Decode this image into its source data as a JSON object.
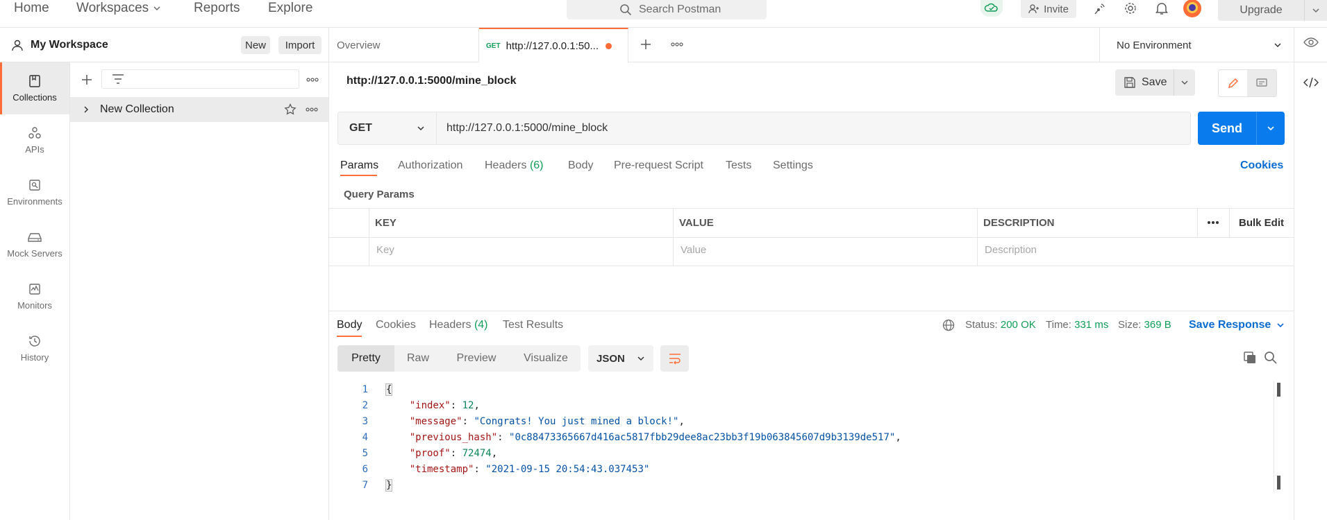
{
  "topbar": {
    "nav": [
      "Home",
      "Workspaces",
      "Reports",
      "Explore"
    ],
    "search_placeholder": "Search Postman",
    "invite_label": "Invite",
    "upgrade_label": "Upgrade"
  },
  "workspace": {
    "name": "My Workspace",
    "new_label": "New",
    "import_label": "Import"
  },
  "rail": [
    {
      "label": "Collections",
      "icon": "collections-icon"
    },
    {
      "label": "APIs",
      "icon": "apis-icon"
    },
    {
      "label": "Environments",
      "icon": "environments-icon"
    },
    {
      "label": "Mock Servers",
      "icon": "mock-servers-icon"
    },
    {
      "label": "Monitors",
      "icon": "monitors-icon"
    },
    {
      "label": "History",
      "icon": "history-icon"
    }
  ],
  "collections": {
    "items": [
      {
        "name": "New Collection"
      }
    ]
  },
  "tabs": {
    "overview_label": "Overview",
    "active_method": "GET",
    "active_title": "http://127.0.0.1:50..."
  },
  "environment": {
    "selected": "No Environment"
  },
  "request": {
    "title": "http://127.0.0.1:5000/mine_block",
    "save_label": "Save",
    "method": "GET",
    "url": "http://127.0.0.1:5000/mine_block",
    "send_label": "Send",
    "subtabs": {
      "params": "Params",
      "authorization": "Authorization",
      "headers": "Headers",
      "headers_count": "(6)",
      "body": "Body",
      "prerequest": "Pre-request Script",
      "tests": "Tests",
      "settings": "Settings"
    },
    "cookies_label": "Cookies",
    "query_params_title": "Query Params",
    "table": {
      "headers": [
        "KEY",
        "VALUE",
        "DESCRIPTION"
      ],
      "bulk_edit_label": "Bulk Edit",
      "placeholders": [
        "Key",
        "Value",
        "Description"
      ]
    }
  },
  "response": {
    "tabs": {
      "body": "Body",
      "cookies": "Cookies",
      "headers": "Headers",
      "headers_count": "(4)",
      "test_results": "Test Results"
    },
    "status_label": "Status:",
    "status_value": "200 OK",
    "time_label": "Time:",
    "time_value": "331 ms",
    "size_label": "Size:",
    "size_value": "369 B",
    "save_response_label": "Save Response",
    "views": [
      "Pretty",
      "Raw",
      "Preview",
      "Visualize"
    ],
    "format": "JSON",
    "body_lines": {
      "l1_open": "{",
      "index_key": "\"index\"",
      "index_val": "12",
      "message_key": "\"message\"",
      "message_val": "\"Congrats! You just mined a block!\"",
      "prev_key": "\"previous_hash\"",
      "prev_val": "\"0c88473365667d416ac5817fbb29dee8ac23bb3f19b063845607d9b3139de517\"",
      "proof_key": "\"proof\"",
      "proof_val": "72474",
      "ts_key": "\"timestamp\"",
      "ts_val": "\"2021-09-15 20:54:43.037453\"",
      "l7_close": "}"
    },
    "line_numbers": [
      "1",
      "2",
      "3",
      "4",
      "5",
      "6",
      "7"
    ]
  },
  "colors": {
    "accent": "#ff6c37",
    "send_blue": "#097bed",
    "link_blue": "#0a6bd1",
    "status_green": "#0f9d58"
  }
}
